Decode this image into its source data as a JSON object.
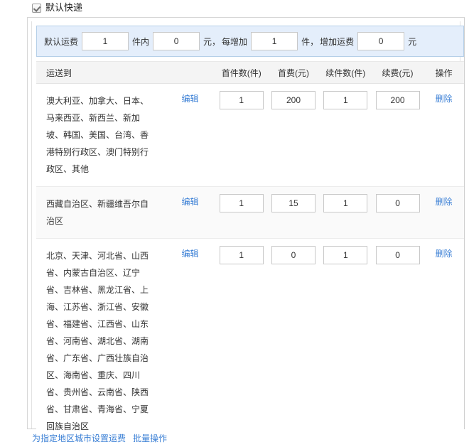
{
  "checkbox": {
    "label": "默认快递",
    "checked": true
  },
  "toolbar": {
    "label_default_fee": "默认运费",
    "first_qty": "1",
    "label_within": "件内",
    "first_fee": "0",
    "unit_yuan_1": "元，",
    "label_each_add": "每增加",
    "add_qty": "1",
    "unit_piece": "件，",
    "label_add_fee": "增加运费",
    "add_fee": "0",
    "unit_yuan_2": "元"
  },
  "table": {
    "headers": {
      "dest": "运送到",
      "first_qty": "首件数(件)",
      "first_fee": "首费(元)",
      "next_qty": "续件数(件)",
      "next_fee": "续费(元)",
      "action": "操作"
    },
    "edit_label": "编辑",
    "delete_label": "删除",
    "rows": [
      {
        "dest": "澳大利亚、加拿大、日本、马来西亚、新西兰、新加坡、韩国、美国、台湾、香港特别行政区、澳门特别行政区、其他",
        "first_qty": "1",
        "first_fee": "200",
        "next_qty": "1",
        "next_fee": "200"
      },
      {
        "dest": "西藏自治区、新疆维吾尔自治区",
        "first_qty": "1",
        "first_fee": "15",
        "next_qty": "1",
        "next_fee": "0"
      },
      {
        "dest": "北京、天津、河北省、山西省、内蒙古自治区、辽宁省、吉林省、黑龙江省、上海、江苏省、浙江省、安徽省、福建省、江西省、山东省、河南省、湖北省、湖南省、广东省、广西壮族自治区、海南省、重庆、四川省、贵州省、云南省、陕西省、甘肃省、青海省、宁夏回族自治区",
        "first_qty": "1",
        "first_fee": "0",
        "next_qty": "1",
        "next_fee": "0"
      }
    ]
  },
  "footer": {
    "set_region_fee": "为指定地区城市设置运费",
    "batch_operation": "批量操作"
  },
  "colors": {
    "link": "#3a7fd5",
    "toolbar_bg": "#e4eefb",
    "toolbar_border": "#b5cfe8",
    "header_bg": "#f4f4f4",
    "row_alt_bg": "#fafafa"
  }
}
